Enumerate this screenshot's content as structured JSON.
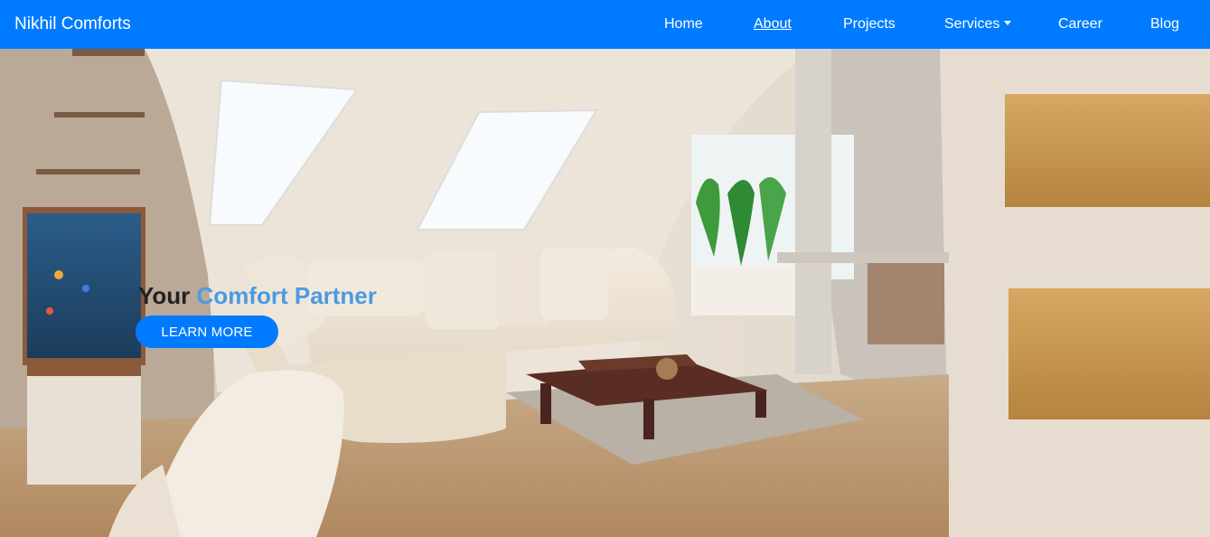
{
  "brand": {
    "name": "Nikhil Comforts"
  },
  "nav": {
    "home": "Home",
    "about": "About",
    "projects": "Projects",
    "services": "Services",
    "career": "Career",
    "blog": "Blog"
  },
  "hero": {
    "headline_prefix": "Your",
    "headline_accent": "Comfort Partner",
    "cta_label": "LEARN MORE",
    "image_description_icon": "living-room-photo"
  },
  "colors": {
    "navbar": "#007bff",
    "accent_text": "#4a9be0",
    "button": "#007bff"
  }
}
